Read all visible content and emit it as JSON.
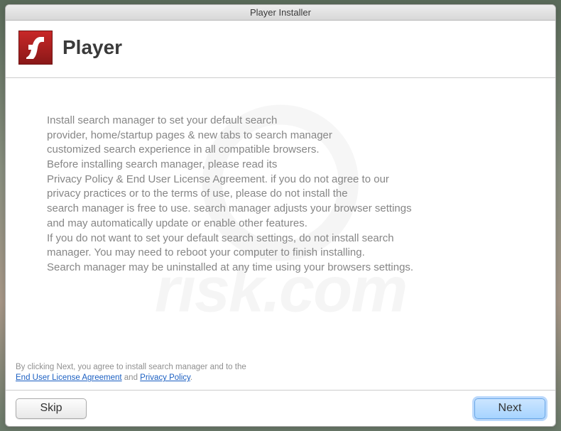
{
  "window": {
    "title": "Player Installer"
  },
  "header": {
    "product": "Player"
  },
  "body": {
    "lines": [
      "Install search manager to set your default search",
      "provider, home/startup pages & new tabs to search manager",
      "customized search experience in all compatible browsers.",
      "Before installing search manager, please read its",
      "Privacy Policy & End User License Agreement. if you do not agree to our",
      "privacy practices or to the terms of use, please do not install the",
      "search manager is free to use. search manager adjusts your browser settings",
      "and may automatically update or enable other features.",
      "If you do not want to set your default search settings, do not install search",
      "manager. You may need to reboot your computer to finish installing.",
      "Search manager may be uninstalled at any time using your browsers settings."
    ]
  },
  "agreement": {
    "prefix": "By clicking Next, you agree to install search manager and to the",
    "eula": "End User License Agreement",
    "and": " and ",
    "privacy": "Privacy Policy",
    "suffix": "."
  },
  "buttons": {
    "skip": "Skip",
    "next": "Next"
  },
  "watermark": {
    "text": "risk.com"
  }
}
